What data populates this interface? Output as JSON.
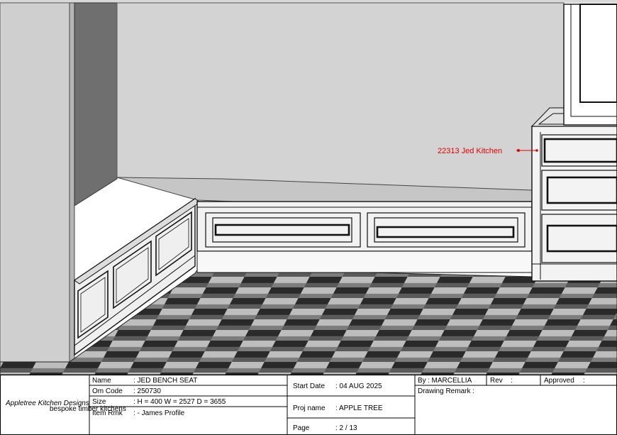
{
  "annotation": {
    "label": "22313 Jed Kitchen",
    "color": "#e30000"
  },
  "logo": {
    "name": "Appletree Kitchen Designs",
    "tagline": "bespoke timber kitchens"
  },
  "info": {
    "name_label": "Name",
    "name_value": ": JED BENCH SEAT",
    "omcode_label": "Om Code",
    "omcode_value": ": 250730",
    "size_label": "Size",
    "size_value": ": H = 400   W = 2527  D = 3655",
    "itemrmk_label": "Item Rmk",
    "itemrmk_value": ": - James Profile"
  },
  "project": {
    "start_label": "Start Date",
    "start_value": ": 04 AUG 2025",
    "proj_label": "Proj name",
    "proj_value": ": APPLE TREE",
    "page_label": "Page",
    "page_value": ": 2 / 13"
  },
  "approval": {
    "by_label": "By",
    "by_value": ": MARCELLIA",
    "rev_label": "Rev",
    "rev_value": ":",
    "approved_label": "Approved",
    "approved_value": ":",
    "remark_label": "Drawing Remark :"
  }
}
